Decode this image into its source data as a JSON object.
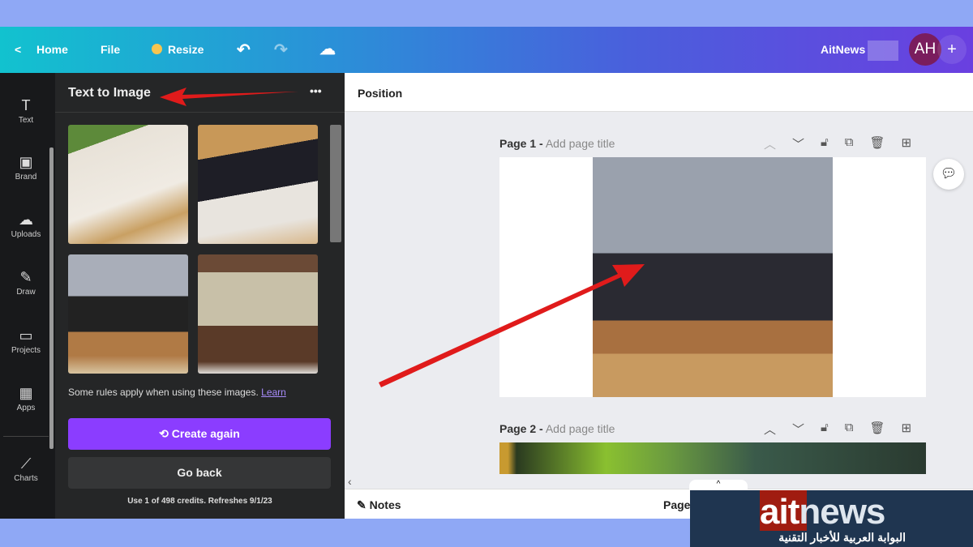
{
  "header": {
    "home": "Home",
    "file": "File",
    "resize": "Resize",
    "team": "AitNews",
    "avatar": "AH",
    "add": "+"
  },
  "rail": [
    {
      "label": "Text",
      "icon": "T"
    },
    {
      "label": "Brand",
      "icon": "▣"
    },
    {
      "label": "Uploads",
      "icon": "☁"
    },
    {
      "label": "Draw",
      "icon": "✎"
    },
    {
      "label": "Projects",
      "icon": "▭"
    },
    {
      "label": "Apps",
      "icon": "▦"
    },
    {
      "label": "Charts",
      "icon": "⟋"
    }
  ],
  "panel": {
    "title": "Text to Image",
    "more": "•••",
    "rules": "Some rules apply when using these images.",
    "learn": "Learn",
    "create": "Create again",
    "back": "Go back",
    "credits": "Use 1 of 498 credits. Refreshes 9/1/23"
  },
  "toolbar": {
    "position": "Position"
  },
  "pages": [
    {
      "label": "Page 1 -",
      "title": "Add page title"
    },
    {
      "label": "Page 2 -",
      "title": "Add page title"
    }
  ],
  "footer": {
    "notes": "Notes",
    "page": "Page"
  },
  "logo": {
    "text_a": "ait",
    "text_b": "news",
    "tagline": "البوابة العربية للأخبار التقنية"
  },
  "colors": {
    "accent": "#8b3dff",
    "arrow": "#e01b1b"
  }
}
